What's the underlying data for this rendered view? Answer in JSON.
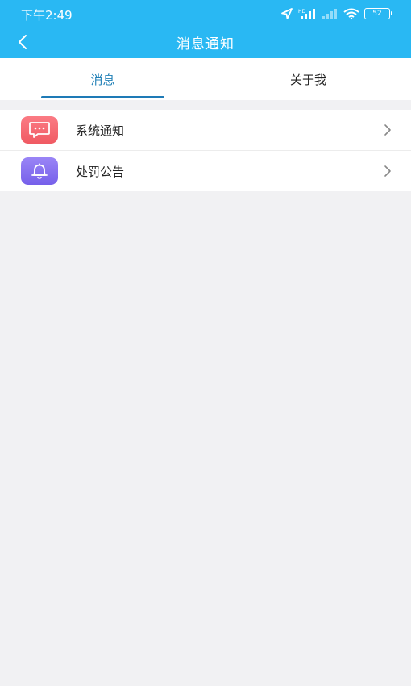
{
  "status_bar": {
    "time": "下午2:49",
    "battery_level": "52",
    "icons": [
      "location-icon",
      "signal-icon",
      "signal-icon",
      "wifi-icon",
      "battery-icon"
    ]
  },
  "header": {
    "title": "消息通知",
    "back_icon": "chevron-left-icon",
    "background_color": "#29b8f3"
  },
  "tabs": [
    {
      "label": "消息",
      "active": true
    },
    {
      "label": "关于我",
      "active": false
    }
  ],
  "list": {
    "items": [
      {
        "label": "系统通知",
        "icon": "message-bubble-icon",
        "icon_color": "#f36670"
      },
      {
        "label": "处罚公告",
        "icon": "bell-icon",
        "icon_color": "#856ff0"
      }
    ]
  },
  "colors": {
    "accent": "#1e7ab6",
    "page_background": "#f1f1f3"
  }
}
